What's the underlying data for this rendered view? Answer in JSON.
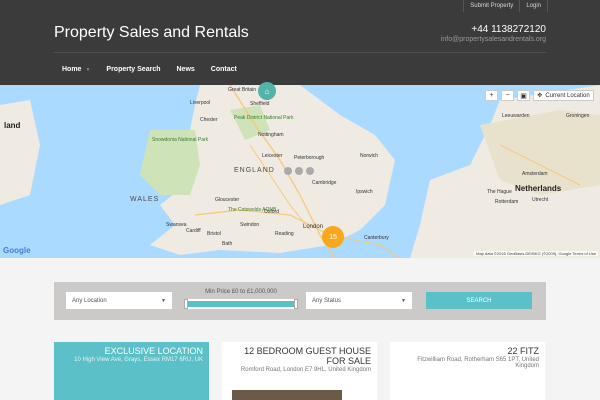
{
  "topbar": {
    "submit_label": "Submit Property",
    "login_label": "Login"
  },
  "header": {
    "title": "Property Sales and Rentals",
    "phone": "+44 1138272120",
    "email": "info@propertysalesandrentals.org"
  },
  "nav": {
    "items": [
      {
        "label": "Home"
      },
      {
        "label": "Property Search"
      },
      {
        "label": "News"
      },
      {
        "label": "Contact"
      }
    ]
  },
  "map": {
    "zoom_in": "+",
    "zoom_out": "−",
    "current_location_label": "Current Location",
    "cluster_count": "15",
    "google_label": "Google",
    "attribution": "Map data ©2016 GeoBasis-DE/BKG (©2009), Google   Terms of Use",
    "labels": {
      "england": "ENGLAND",
      "wales": "WALES",
      "netherlands": "Netherlands",
      "land": "land",
      "liverpool": "Liverpool",
      "sheffield": "Sheffield",
      "great_britain": "Great Britain",
      "chester": "Chester",
      "peak": "Peak District National Park",
      "nottingham": "Nottingham",
      "snowdonia": "Snowdonia National Park",
      "leicester": "Leicester",
      "peterborough": "Peterborough",
      "norwich": "Norwich",
      "cambridge": "Cambridge",
      "ipswich": "Ipswich",
      "gloucester": "Gloucester",
      "oxford": "Oxford",
      "cotswolds": "The Cotswolds AONB",
      "cardiff": "Cardiff",
      "bristol": "Bristol",
      "swindon": "Swindon",
      "reading": "Reading",
      "london": "London",
      "canterbury": "Canterbury",
      "bath": "Bath",
      "swansea": "Swansea",
      "leeuwarden": "Leeuwarden",
      "groningen": "Groningen",
      "amsterdam": "Amsterdam",
      "the_hague": "The Hague",
      "rotterdam": "Rotterdam",
      "utrecht": "Utrecht"
    }
  },
  "search": {
    "location_label": "Any Location",
    "price_label": "Min Price £0 to £1,000,000",
    "status_label": "Any Status",
    "button_label": "SEARCH",
    "price_min_fraction": 0,
    "price_max_fraction": 1
  },
  "cards": [
    {
      "title": "EXCLUSIVE LOCATION",
      "address": "10 High View Ave, Grays, Essex RM17 6RU, UK"
    },
    {
      "title": "12 BEDROOM GUEST HOUSE FOR SALE",
      "address": "Romford Road, London E7 9HL, United Kingdom"
    },
    {
      "title": "22 FITZ",
      "address": "Fitzwilliam Road, Rotherham S65 1PT, United Kingdom"
    }
  ],
  "colors": {
    "accent": "#5bc0c8",
    "header_bg": "#3b3b3b",
    "cluster": "#f7a81c",
    "pin": "#52b3a8"
  }
}
